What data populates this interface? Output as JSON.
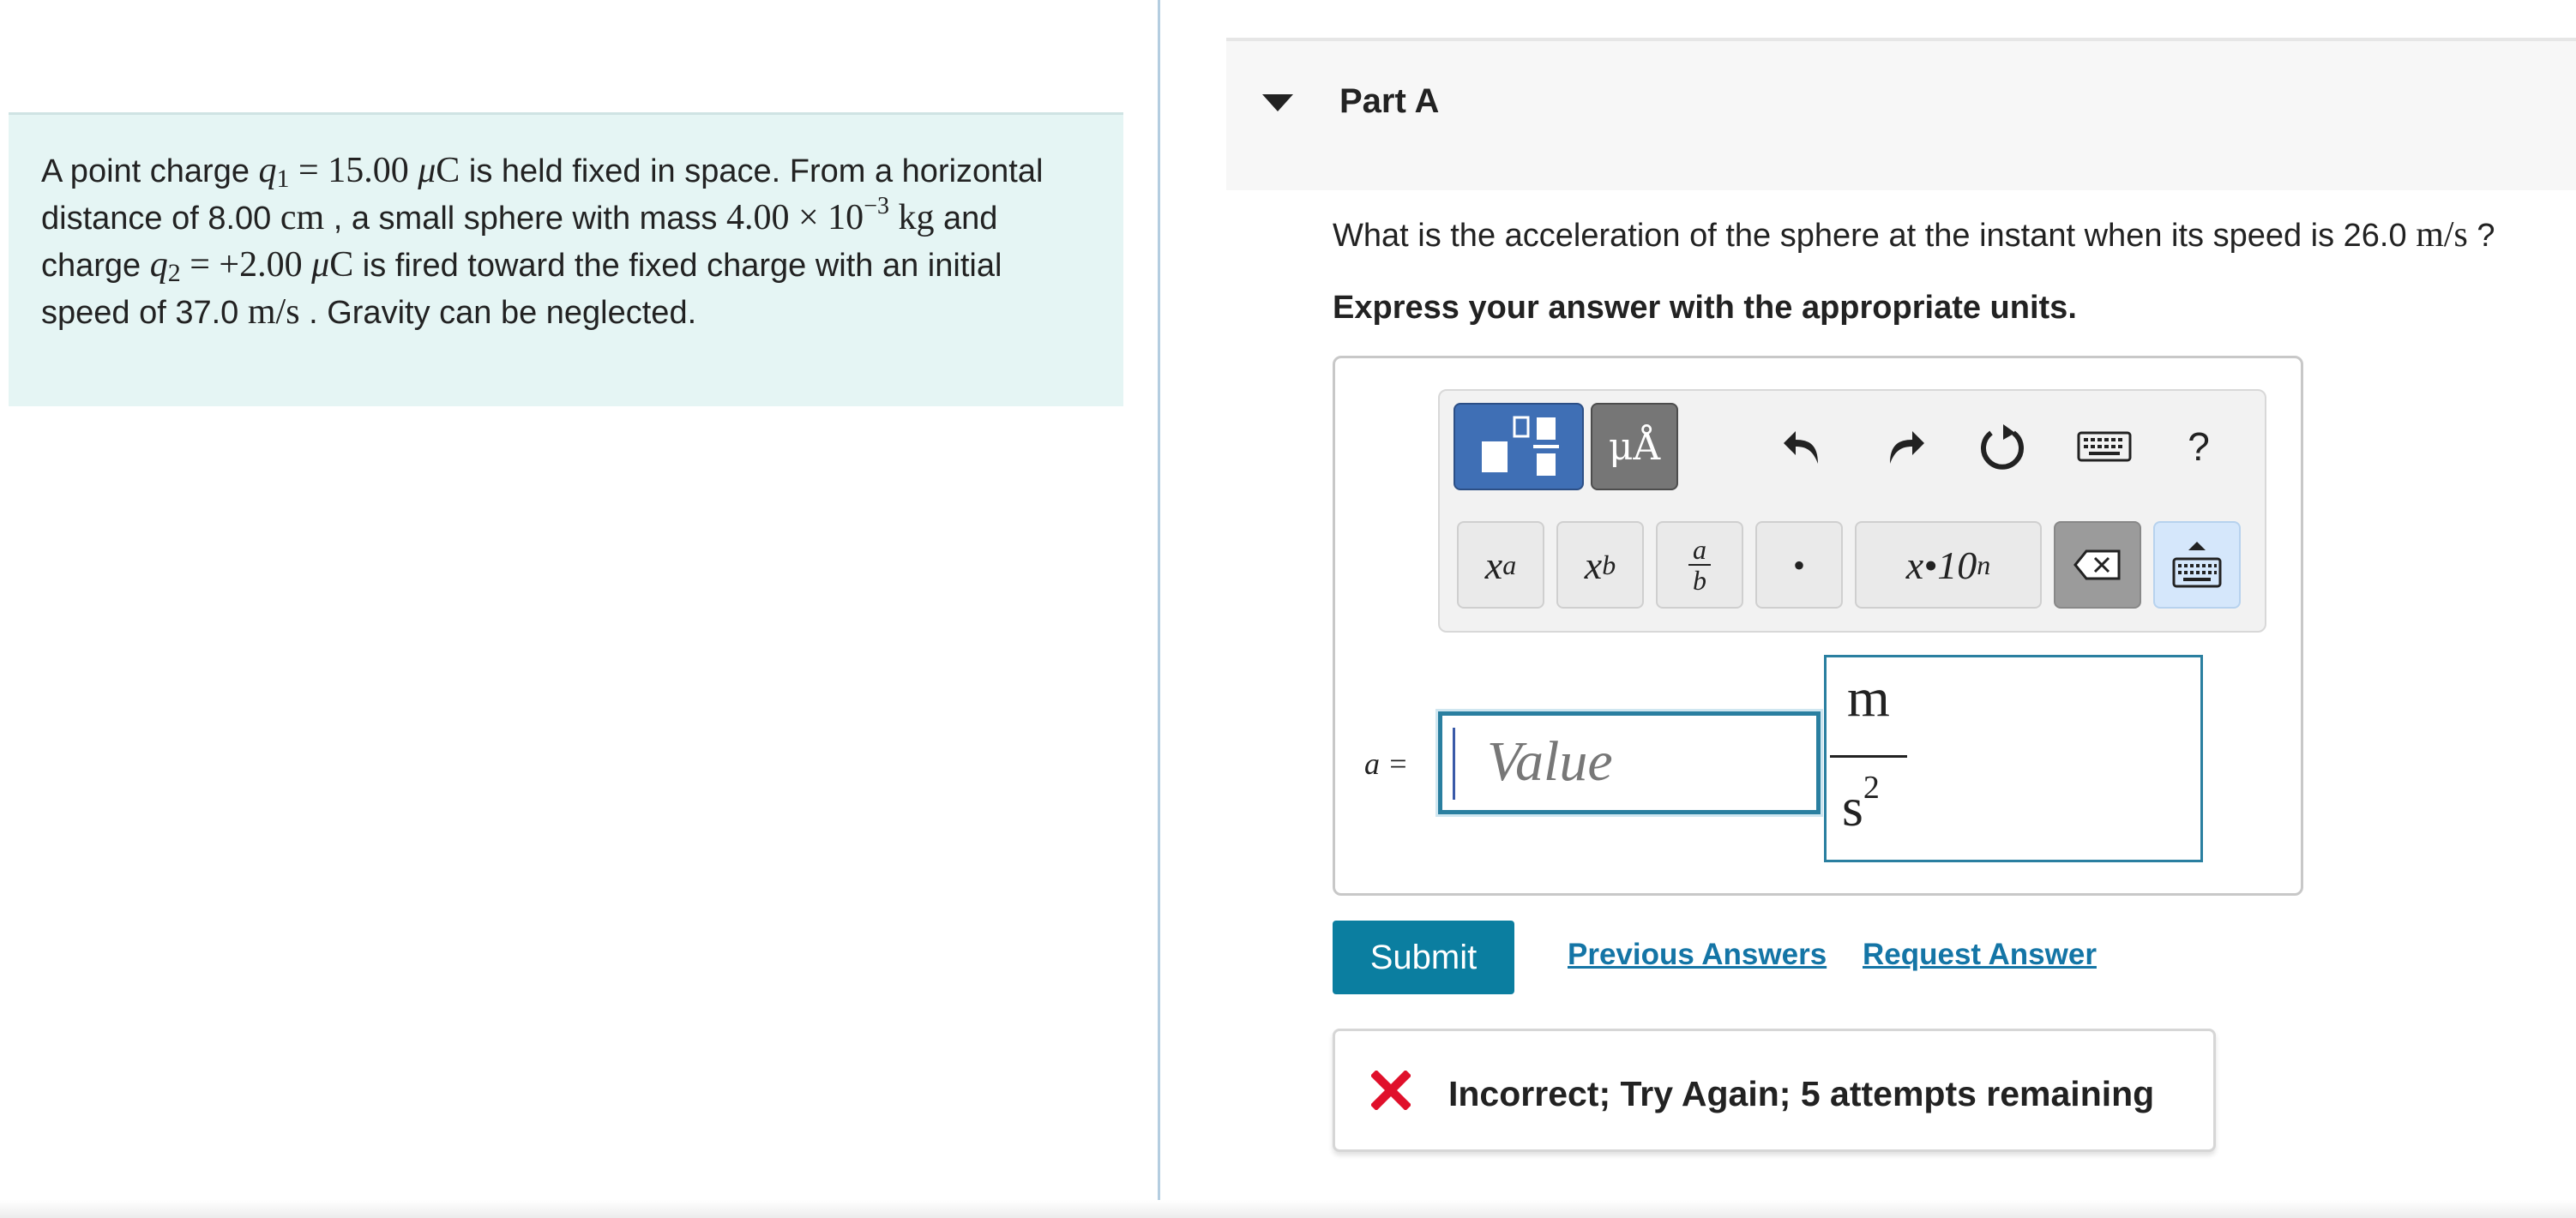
{
  "problem": {
    "t1": "A point charge ",
    "q1_sym": "q",
    "q1_sub": "1",
    "q1_val": " = 15.00 ",
    "mu": "μ",
    "coulomb": "C",
    "t2": " is held fixed in space. From a horizontal distance of 8.00 ",
    "cm": "cm",
    "t3": " , a small sphere with mass ",
    "mass_mantissa": "4.00 × 10",
    "mass_exp": "−3",
    "kg": " kg",
    "t4": " and charge ",
    "q2_sym": "q",
    "q2_sub": "2",
    "q2_val": " = +2.00 ",
    "t5": " is fired toward the fixed charge with an initial speed of 37.0 ",
    "ms": "m/s",
    "t6": " . Gravity can be neglected."
  },
  "part": {
    "title": "Part A"
  },
  "question": {
    "text": "What is the acceleration of the sphere at the instant when its speed is 26.0 ",
    "unit": "m/s",
    "end": " ?"
  },
  "instructions": "Express your answer with the appropriate units.",
  "toolbar": {
    "units_label": "μÅ",
    "help_label": "?",
    "keys": {
      "superscript_base": "x",
      "superscript_exp": "a",
      "subscript_base": "x",
      "subscript_sub": "b",
      "fraction_num": "a",
      "fraction_den": "b",
      "dot": "•",
      "sci_notation": "x•10",
      "sci_exp": "n"
    }
  },
  "answer": {
    "variable": "a =",
    "value_placeholder": "Value",
    "unit_num": "m",
    "unit_den": "s",
    "unit_den_exp": "2"
  },
  "actions": {
    "submit": "Submit",
    "previous_answers": "Previous Answers",
    "request_answer": "Request Answer"
  },
  "feedback": {
    "icon": "x-mark-icon",
    "text": "Incorrect; Try Again; 5 attempts remaining",
    "color": "#e0102b"
  },
  "colors": {
    "problem_bg": "#e5f5f4",
    "submit_bg": "#0b7ea0",
    "link": "#1475a6",
    "input_border": "#2a7fa0"
  }
}
